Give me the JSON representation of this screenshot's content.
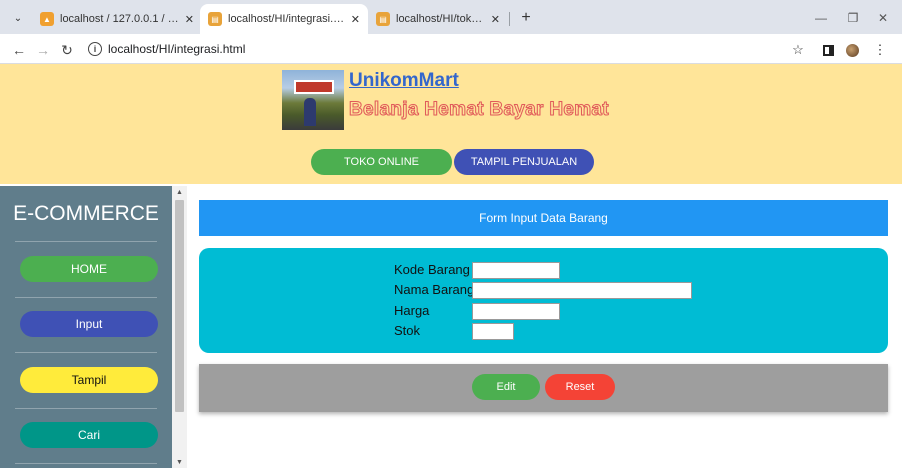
{
  "browser": {
    "tabs": [
      {
        "label": "localhost / 127.0.0.1 / hi_2023 /",
        "active": false
      },
      {
        "label": "localhost/HI/integrasi.html",
        "active": true
      },
      {
        "label": "localhost/HI/toko.php",
        "active": false
      }
    ],
    "new_tab_label": "+",
    "url": "localhost/HI/integrasi.html"
  },
  "header": {
    "site_name": "UnikomMart",
    "tagline": "Belanja Hemat Bayar Hemat",
    "buttons": {
      "toko_online": "TOKO ONLINE",
      "tampil_penjualan": "TAMPIL PENJUALAN"
    }
  },
  "sidebar": {
    "title": "E-COMMERCE",
    "items": [
      {
        "label": "HOME",
        "color": "#4caf50"
      },
      {
        "label": "Input",
        "color": "#3f51b5"
      },
      {
        "label": "Tampil",
        "color": "#ffeb3b"
      },
      {
        "label": "Cari",
        "color": "#009688"
      }
    ]
  },
  "form": {
    "title": "Form Input Data Barang",
    "fields": [
      {
        "label": "Kode Barang",
        "value": ""
      },
      {
        "label": "Nama Barang",
        "value": ""
      },
      {
        "label": "Harga",
        "value": ""
      },
      {
        "label": "Stok",
        "value": ""
      }
    ],
    "edit_label": "Edit",
    "reset_label": "Reset"
  },
  "colors": {
    "header_bg": "#ffe599",
    "sidebar_bg": "#607d8b",
    "form_title_bg": "#2196f3",
    "form_panel_bg": "#00bcd4",
    "action_bar_bg": "#9e9e9e"
  }
}
